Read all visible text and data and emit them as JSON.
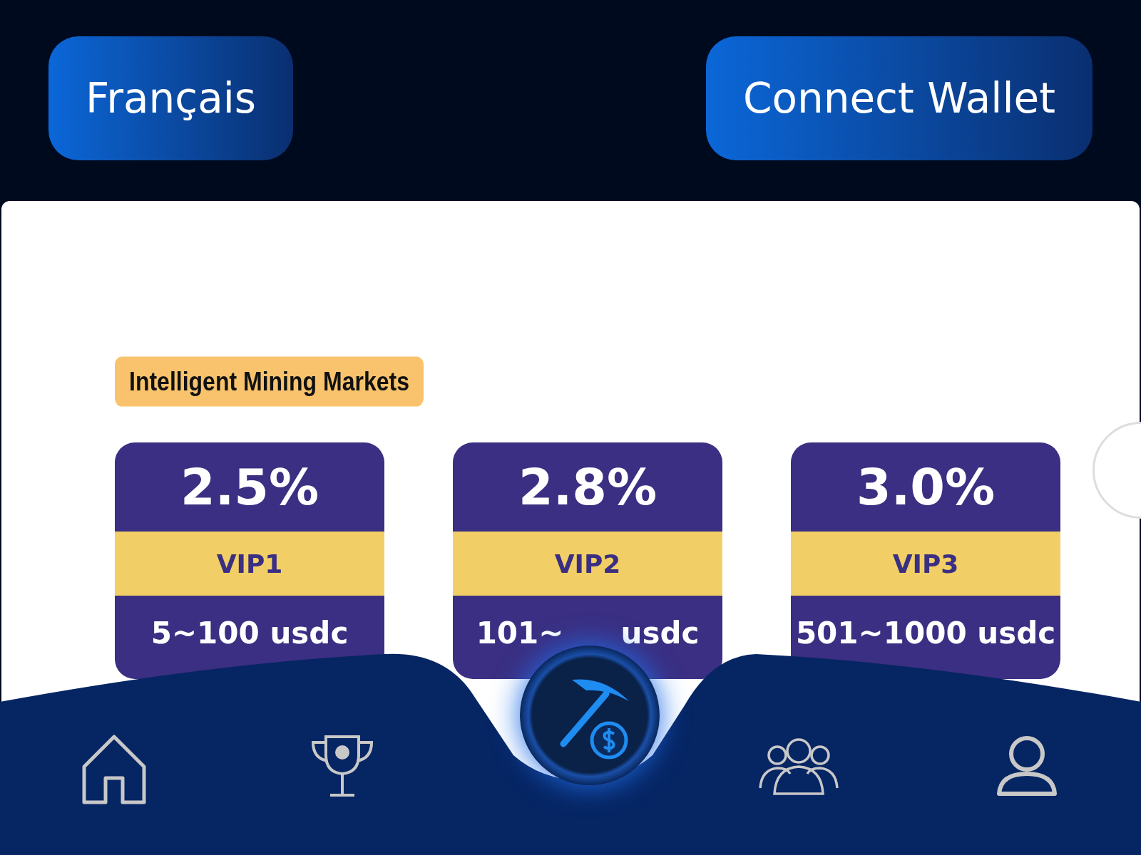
{
  "header": {
    "language_button": "Français",
    "wallet_button": "Connect Wallet"
  },
  "banner": {
    "tag": "Intelligent Mining Markets",
    "plans": [
      {
        "rate": "2.5%",
        "tier": "VIP1",
        "range": "5~100 usdc"
      },
      {
        "rate": "2.8%",
        "tier": "VIP2",
        "range_start": "101~",
        "range_end": "usdc"
      },
      {
        "rate": "3.0%",
        "tier": "VIP3",
        "range": "501~1000 usdc"
      }
    ]
  },
  "nav": {
    "items": [
      {
        "kind": "home"
      },
      {
        "kind": "trophy"
      },
      {
        "kind": "mine"
      },
      {
        "kind": "team"
      },
      {
        "kind": "user"
      }
    ]
  }
}
